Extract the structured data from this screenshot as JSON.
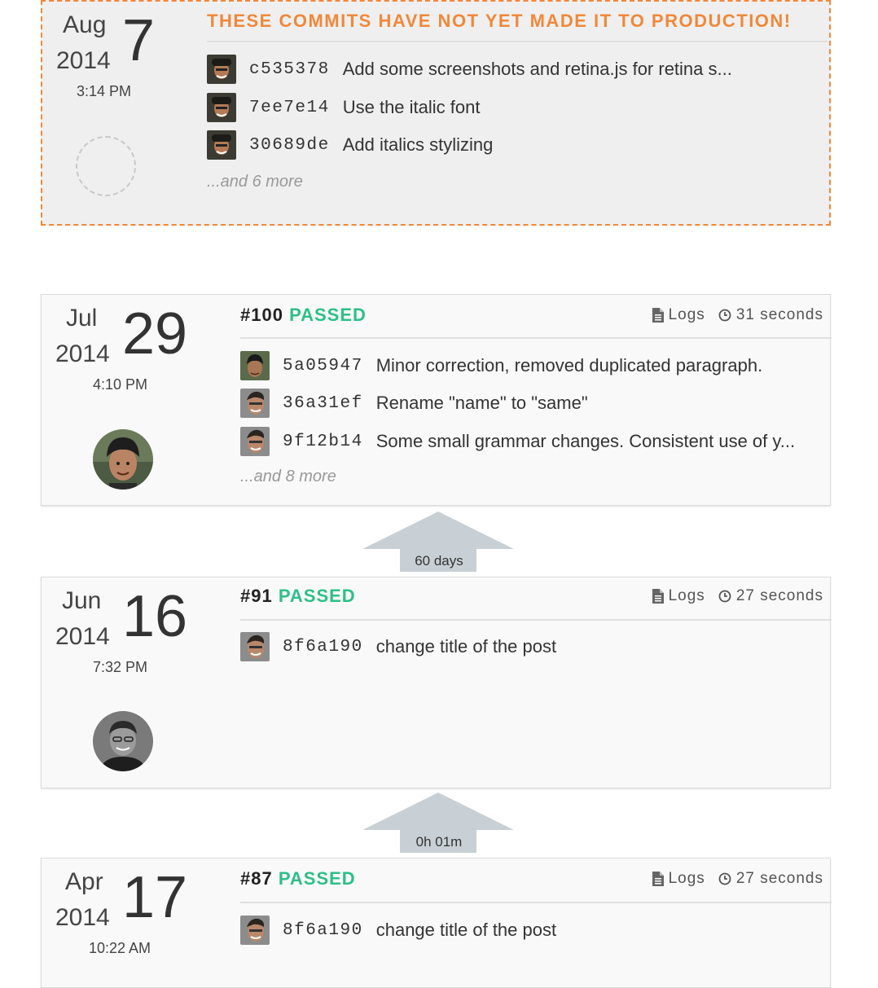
{
  "pending": {
    "title": "THESE COMMITS HAVE NOT YET MADE IT TO PRODUCTION!",
    "date": {
      "month": "Aug",
      "year": "2014",
      "day": "7",
      "time": "3:14 PM"
    },
    "commits": [
      {
        "sha": "c535378",
        "message": "Add some screenshots and retina.js for retina s..."
      },
      {
        "sha": "7ee7e14",
        "message": "Use the italic font"
      },
      {
        "sha": "30689de",
        "message": "Add italics stylizing"
      }
    ],
    "more": "...and 6 more"
  },
  "builds": [
    {
      "number": "#100",
      "status": "PASSED",
      "logs": "Logs",
      "duration": "31 seconds",
      "date": {
        "month": "Jul",
        "year": "2014",
        "day": "29",
        "time": "4:10 PM"
      },
      "commits": [
        {
          "sha": "5a05947",
          "message": "Minor correction, removed duplicated paragraph."
        },
        {
          "sha": "36a31ef",
          "message": "Rename \"name\" to \"same\""
        },
        {
          "sha": "9f12b14",
          "message": "Some small grammar changes. Consistent use of y..."
        }
      ],
      "more": "...and 8 more"
    },
    {
      "number": "#91",
      "status": "PASSED",
      "logs": "Logs",
      "duration": "27 seconds",
      "date": {
        "month": "Jun",
        "year": "2014",
        "day": "16",
        "time": "7:32 PM"
      },
      "commits": [
        {
          "sha": "8f6a190",
          "message": "change title of the post"
        }
      ]
    },
    {
      "number": "#87",
      "status": "PASSED",
      "logs": "Logs",
      "duration": "27 seconds",
      "date": {
        "month": "Apr",
        "year": "2014",
        "day": "17",
        "time": "10:22 AM"
      },
      "commits": [
        {
          "sha": "8f6a190",
          "message": "change title of the post"
        }
      ]
    }
  ],
  "gaps": [
    "60 days",
    "0h 01m"
  ],
  "colors": {
    "accent_orange": "#f0883a",
    "passed_green": "#2dbf88",
    "arrow_gray": "#c8d0d5"
  }
}
